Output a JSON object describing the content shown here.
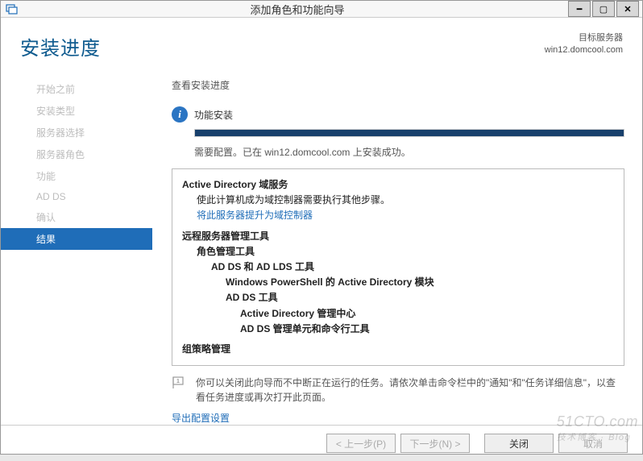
{
  "window": {
    "title": "添加角色和功能向导"
  },
  "header": {
    "page_title": "安装进度",
    "target_label": "目标服务器",
    "target_server": "win12.domcool.com"
  },
  "sidebar": {
    "items": [
      {
        "label": "开始之前",
        "active": false
      },
      {
        "label": "安装类型",
        "active": false
      },
      {
        "label": "服务器选择",
        "active": false
      },
      {
        "label": "服务器角色",
        "active": false
      },
      {
        "label": "功能",
        "active": false
      },
      {
        "label": "AD DS",
        "active": false
      },
      {
        "label": "确认",
        "active": false
      },
      {
        "label": "结果",
        "active": true
      }
    ]
  },
  "main": {
    "section_label": "查看安装进度",
    "status_text": "功能安装",
    "status_msg": "需要配置。已在 win12.domcool.com 上安装成功。",
    "results": {
      "ad_ds_title": "Active Directory 域服务",
      "ad_ds_desc": "使此计算机成为域控制器需要执行其他步骤。",
      "promote_link": "将此服务器提升为域控制器",
      "remote_tools": "远程服务器管理工具",
      "role_tools": "角色管理工具",
      "adds_lds_tools": "AD DS 和 AD LDS 工具",
      "powershell_module": "Windows PowerShell 的 Active Directory 模块",
      "adds_tools": "AD DS 工具",
      "ad_admin_center": "Active Directory 管理中心",
      "adds_snapins": "AD DS 管理单元和命令行工具",
      "gpm": "组策略管理"
    },
    "note": "你可以关闭此向导而不中断正在运行的任务。请依次单击命令栏中的\"通知\"和\"任务详细信息\"，以查看任务进度或再次打开此页面。",
    "export_link": "导出配置设置"
  },
  "footer": {
    "prev": "< 上一步(P)",
    "next": "下一步(N) >",
    "close": "关闭",
    "cancel": "取消"
  },
  "watermark": {
    "line1": "51CTO.com",
    "line2": "技术博客 · Blog"
  }
}
